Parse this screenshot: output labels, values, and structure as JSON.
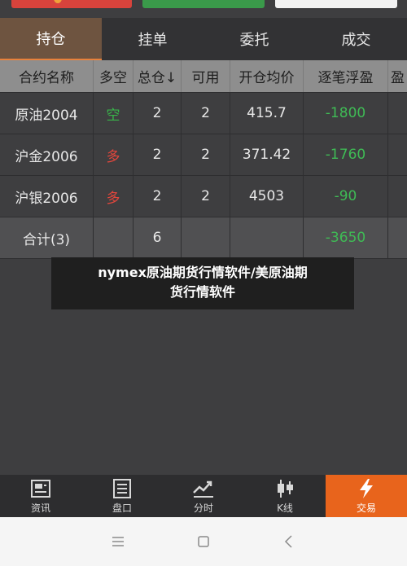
{
  "tabs": [
    {
      "label": "持仓",
      "active": true
    },
    {
      "label": "挂单",
      "active": false
    },
    {
      "label": "委托",
      "active": false
    },
    {
      "label": "成交",
      "active": false
    }
  ],
  "table": {
    "headers": [
      "合约名称",
      "多空",
      "总仓↓",
      "可用",
      "开仓均价",
      "逐笔浮盈",
      "盈"
    ],
    "rows": [
      {
        "name": "原油2004",
        "direction": "空",
        "total": "2",
        "available": "2",
        "avg_price": "415.7",
        "pnl": "-1800"
      },
      {
        "name": "沪金2006",
        "direction": "多",
        "total": "2",
        "available": "2",
        "avg_price": "371.42",
        "pnl": "-1760"
      },
      {
        "name": "沪银2006",
        "direction": "多",
        "total": "2",
        "available": "2",
        "avg_price": "4503",
        "pnl": "-90"
      }
    ],
    "total_row": {
      "label": "合计(3)",
      "total": "6",
      "pnl": "-3650"
    }
  },
  "caption": {
    "line1": "nymex原油期货行情软件/美原油期",
    "line2": "货行情软件"
  },
  "bottom_nav": [
    {
      "label": "资讯",
      "icon": "news-icon",
      "active": false
    },
    {
      "label": "盘口",
      "icon": "orderbook-icon",
      "active": false
    },
    {
      "label": "分时",
      "icon": "timeshare-icon",
      "active": false
    },
    {
      "label": "K线",
      "icon": "kline-icon",
      "active": false
    },
    {
      "label": "交易",
      "icon": "lightning-icon",
      "active": true
    }
  ],
  "colors": {
    "accent": "#e8641c",
    "short": "#38b64a",
    "long": "#e2463c",
    "loss": "#3fbb55"
  }
}
